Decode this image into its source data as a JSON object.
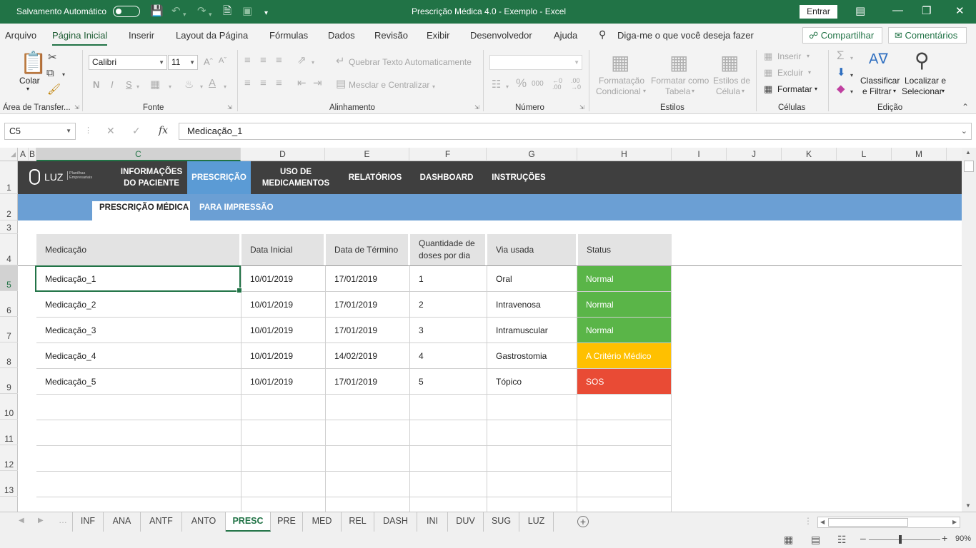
{
  "titlebar": {
    "autosave_label": "Salvamento Automático",
    "title": "Prescrição Médica 4.0 - Exemplo  -  Excel",
    "signin": "Entrar"
  },
  "menu": {
    "items": [
      "Arquivo",
      "Página Inicial",
      "Inserir",
      "Layout da Página",
      "Fórmulas",
      "Dados",
      "Revisão",
      "Exibir",
      "Desenvolvedor",
      "Ajuda"
    ],
    "active": "Página Inicial",
    "tell_me": "Diga-me o que você deseja fazer",
    "share": "Compartilhar",
    "comments": "Comentários"
  },
  "ribbon": {
    "clipboard": {
      "paste": "Colar",
      "group": "Área de Transfer..."
    },
    "font": {
      "name": "Calibri",
      "size": "11",
      "bold": "N",
      "italic": "I",
      "underline": "S",
      "group": "Fonte"
    },
    "alignment": {
      "wrap": "Quebrar Texto Automaticamente",
      "merge": "Mesclar e Centralizar",
      "group": "Alinhamento"
    },
    "number": {
      "format": "",
      "group": "Número"
    },
    "styles": {
      "conditional": [
        "Formatação",
        "Condicional"
      ],
      "as_table": [
        "Formatar como",
        "Tabela"
      ],
      "cell_styles": [
        "Estilos de",
        "Célula"
      ],
      "group": "Estilos"
    },
    "cells": {
      "insert": "Inserir",
      "delete": "Excluir",
      "format": "Formatar",
      "group": "Células"
    },
    "editing": {
      "sort": [
        "Classificar",
        "e Filtrar"
      ],
      "find": [
        "Localizar e",
        "Selecionar"
      ],
      "group": "Edição"
    }
  },
  "formula_bar": {
    "name_box": "C5",
    "formula": "Medicação_1"
  },
  "columns": [
    "A",
    "B",
    "C",
    "D",
    "E",
    "F",
    "G",
    "H",
    "I",
    "J",
    "K",
    "L",
    "M"
  ],
  "rows": [
    "1",
    "2",
    "3",
    "4",
    "5",
    "6",
    "7",
    "8",
    "9",
    "10",
    "11",
    "12",
    "13"
  ],
  "sheet_nav": {
    "logo": "LUZ",
    "logo_sub": [
      "Planilhas",
      "Empresariais"
    ],
    "items": [
      [
        "INFORMAÇÕES",
        "DO PACIENTE"
      ],
      [
        "PRESCRIÇÃO"
      ],
      [
        "USO DE",
        "MEDICAMENTOS"
      ],
      [
        "RELATÓRIOS"
      ],
      [
        "DASHBOARD"
      ],
      [
        "INSTRUÇÕES"
      ]
    ],
    "sub_items": [
      "PRESCRIÇÃO MÉDICA",
      "PARA IMPRESSÃO"
    ]
  },
  "table": {
    "headers": [
      "Medicação",
      "Data Inicial",
      "Data de Término",
      "Quantidade de doses por dia",
      "Via usada",
      "Status"
    ],
    "rows": [
      [
        "Medicação_1",
        "10/01/2019",
        "17/01/2019",
        "1",
        "Oral",
        "Normal"
      ],
      [
        "Medicação_2",
        "10/01/2019",
        "17/01/2019",
        "2",
        "Intravenosa",
        "Normal"
      ],
      [
        "Medicação_3",
        "10/01/2019",
        "17/01/2019",
        "3",
        "Intramuscular",
        "Normal"
      ],
      [
        "Medicação_4",
        "10/01/2019",
        "14/02/2019",
        "4",
        "Gastrostomia",
        "A Critério Médico"
      ],
      [
        "Medicação_5",
        "10/01/2019",
        "17/01/2019",
        "5",
        "Tópico",
        "SOS"
      ]
    ],
    "status_colors": {
      "Normal": "#5ab548",
      "A Critério Médico": "#ffc000",
      "SOS": "#e94b35"
    }
  },
  "sheet_tabs": [
    "INF",
    "ANA",
    "ANTF",
    "ANTO",
    "PRESC",
    "PRE",
    "MED",
    "REL",
    "DASH",
    "INI",
    "DUV",
    "SUG",
    "LUZ"
  ],
  "active_tab": "PRESC",
  "status": {
    "zoom": "90%"
  }
}
